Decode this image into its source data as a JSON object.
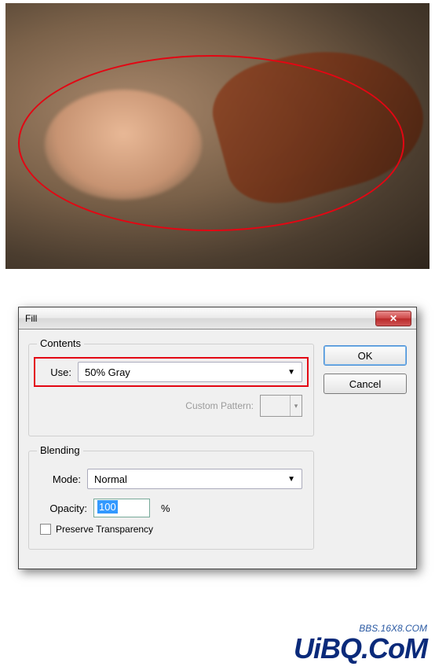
{
  "dialog": {
    "title": "Fill",
    "contents": {
      "legend": "Contents",
      "use_label": "Use:",
      "use_value": "50% Gray",
      "custom_pattern_label": "Custom Pattern:"
    },
    "blending": {
      "legend": "Blending",
      "mode_label": "Mode:",
      "mode_value": "Normal",
      "opacity_label": "Opacity:",
      "opacity_value": "100",
      "opacity_unit": "%",
      "preserve_label": "Preserve Transparency"
    },
    "buttons": {
      "ok": "OK",
      "cancel": "Cancel"
    }
  },
  "watermark": {
    "main": "UiBQ.CoM",
    "sub": "BBS.16X8.COM"
  }
}
